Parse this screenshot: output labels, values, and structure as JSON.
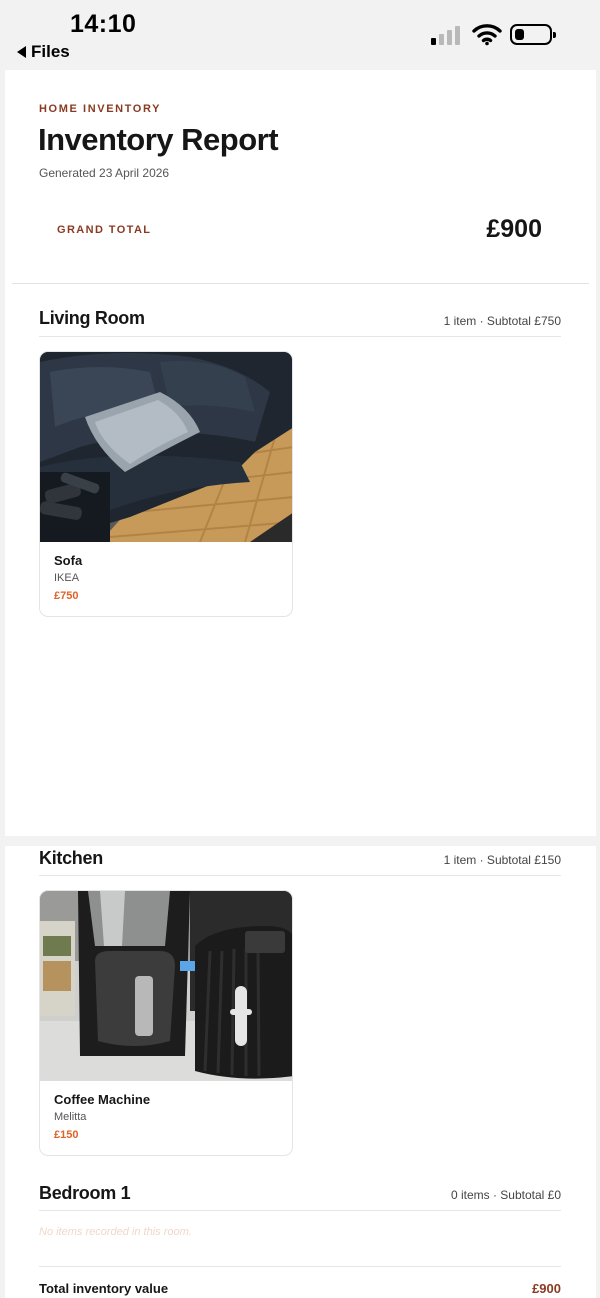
{
  "status_bar": {
    "time": "14:10",
    "back_label": "Files"
  },
  "report": {
    "eyebrow": "HOME INVENTORY",
    "title": "Inventory Report",
    "generated": "Generated 23 April 2026",
    "grand_total_label": "GRAND TOTAL",
    "grand_total_value": "£900"
  },
  "rooms": [
    {
      "name": "Living Room",
      "meta": "1 item · Subtotal £750",
      "items": [
        {
          "name": "Sofa",
          "brand": "IKEA",
          "price": "£750"
        }
      ]
    },
    {
      "name": "Kitchen",
      "meta": "1 item · Subtotal £150",
      "items": [
        {
          "name": "Coffee Machine",
          "brand": "Melitta",
          "price": "£150"
        }
      ]
    },
    {
      "name": "Bedroom 1",
      "meta": "0 items · Subtotal £0",
      "empty_note": "No items recorded in this room."
    }
  ],
  "footer": {
    "total_label": "Total inventory value",
    "total_value": "£900"
  }
}
